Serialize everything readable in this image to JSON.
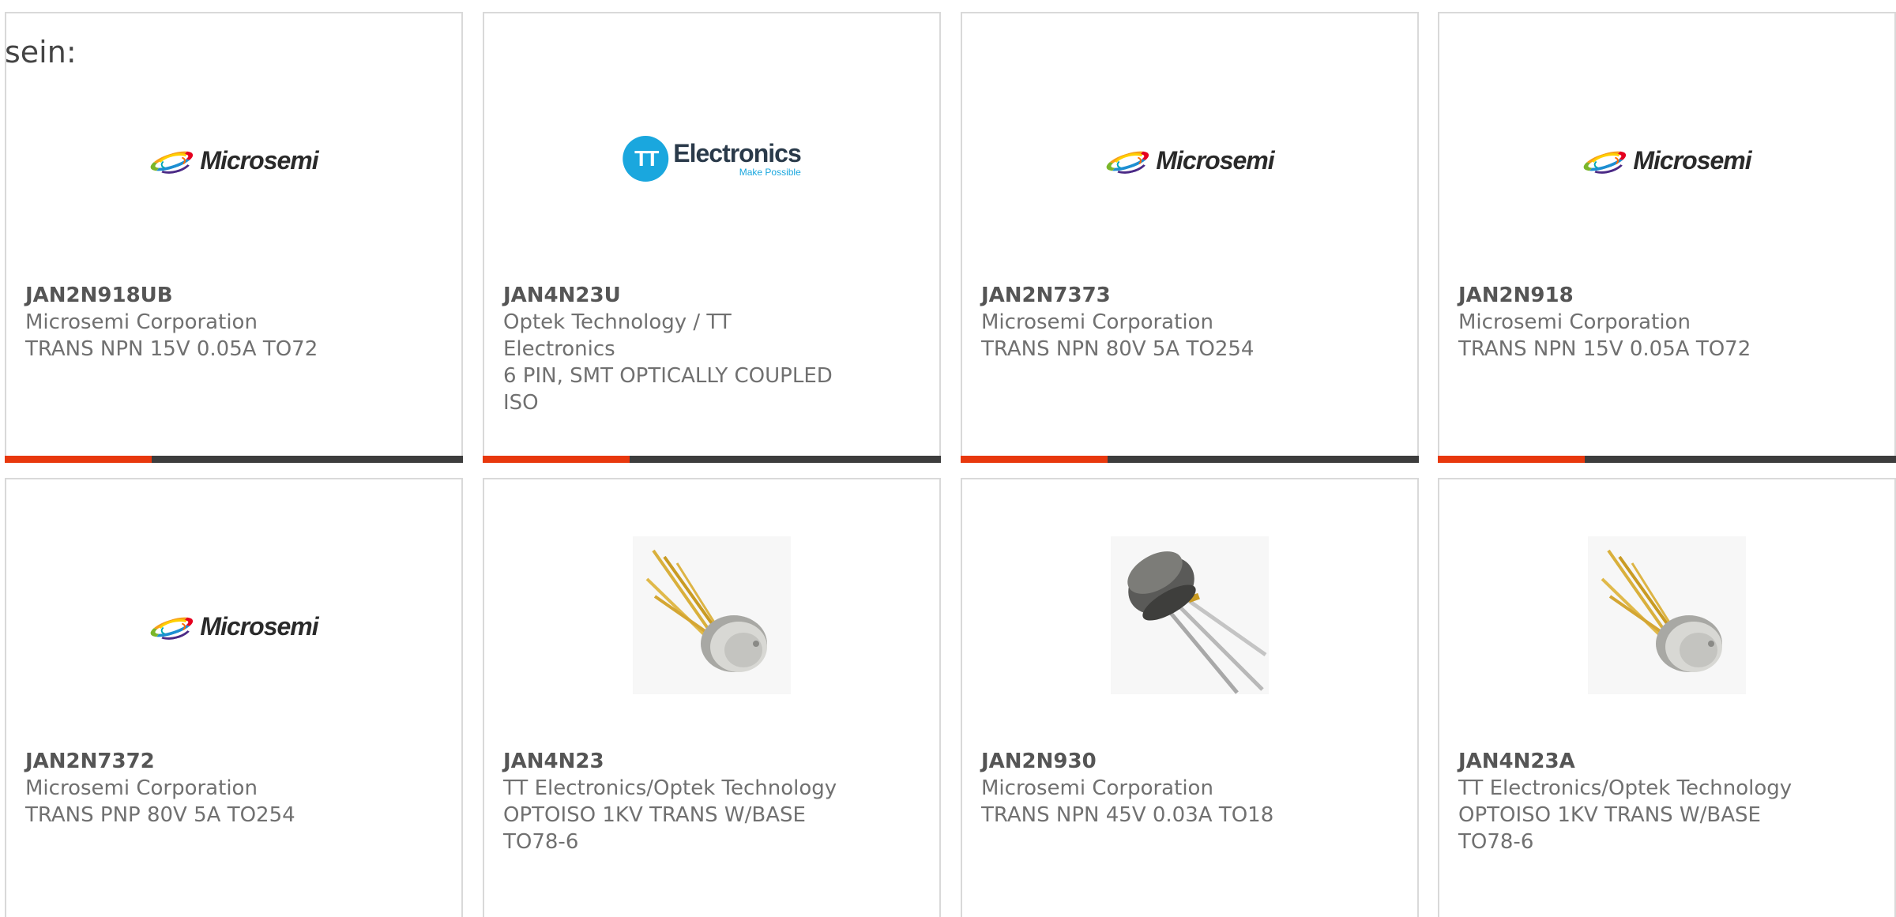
{
  "page": {
    "label": "sein:"
  },
  "brands": {
    "microsemi": {
      "word": "Microsemi"
    },
    "tt": {
      "mark": "TT",
      "word": "Electronics",
      "tagline": "Make Possible"
    }
  },
  "colors": {
    "accent": "#e8380d",
    "track": "#3d3d3d",
    "tt_blue": "#1aa7de"
  },
  "cards": [
    {
      "part_number": "JAN2N918UB",
      "manufacturer": "Microsemi Corporation",
      "description": "TRANS NPN 15V 0.05A TO72",
      "image": "microsemi-logo",
      "progress": 0.32
    },
    {
      "part_number": "JAN4N23U",
      "manufacturer": "Optek Technology / TT Electronics",
      "description": "6 PIN, SMT OPTICALLY COUPLED ISO",
      "image": "tt-electronics-logo",
      "progress": 0.32
    },
    {
      "part_number": "JAN2N7373",
      "manufacturer": "Microsemi Corporation",
      "description": "TRANS NPN 80V 5A TO254",
      "image": "microsemi-logo",
      "progress": 0.32
    },
    {
      "part_number": "JAN2N918",
      "manufacturer": "Microsemi Corporation",
      "description": "TRANS NPN 15V 0.05A TO72",
      "image": "microsemi-logo",
      "progress": 0.32
    },
    {
      "part_number": "JAN2N7372",
      "manufacturer": "Microsemi Corporation",
      "description": "TRANS PNP 80V 5A TO254",
      "image": "microsemi-logo"
    },
    {
      "part_number": "JAN4N23",
      "manufacturer": "TT Electronics/Optek Technology",
      "description": "OPTOISO 1KV TRANS W/BASE TO78-6",
      "image": "to78-metal-can-photo"
    },
    {
      "part_number": "JAN2N930",
      "manufacturer": "Microsemi Corporation",
      "description": "TRANS NPN 45V 0.03A TO18",
      "image": "to18-metal-can-photo"
    },
    {
      "part_number": "JAN4N23A",
      "manufacturer": "TT Electronics/Optek Technology",
      "description": "OPTOISO 1KV TRANS W/BASE TO78-6",
      "image": "to78-metal-can-photo"
    }
  ]
}
